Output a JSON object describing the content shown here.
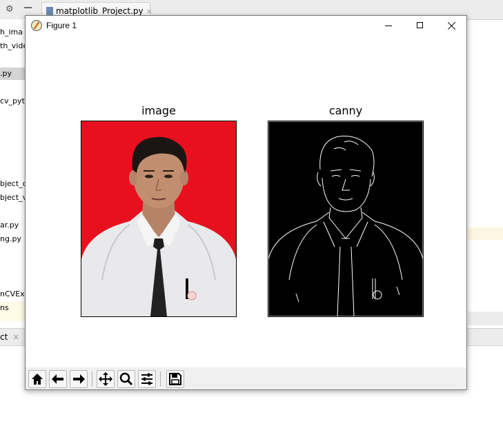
{
  "ide": {
    "tab": {
      "label": "matplotlib_Project.py",
      "close": "×"
    },
    "sidebar_items": [
      "h_ima",
      "th_vide",
      ".py",
      "cv_pyt",
      "bject_d",
      "bject_v",
      "ar.py",
      "ng.py",
      "nCVExa",
      "ns"
    ],
    "bottom_tab": {
      "label": "ct",
      "close": "×"
    },
    "icons": [
      "gear-icon",
      "minimize-panel-icon"
    ]
  },
  "window": {
    "title": "Figure 1",
    "controls": [
      "minimize",
      "maximize",
      "close"
    ]
  },
  "figure": {
    "subplots": [
      {
        "title": "image"
      },
      {
        "title": "canny"
      }
    ]
  },
  "toolbar": {
    "buttons": [
      "home-icon",
      "back-icon",
      "forward-icon",
      "pan-icon",
      "zoom-icon",
      "configure-subplots-icon",
      "save-icon"
    ]
  },
  "colors": {
    "image_background": "#e8101f",
    "canny_background": "#000000",
    "toolbar_background": "#f0f0f0"
  }
}
